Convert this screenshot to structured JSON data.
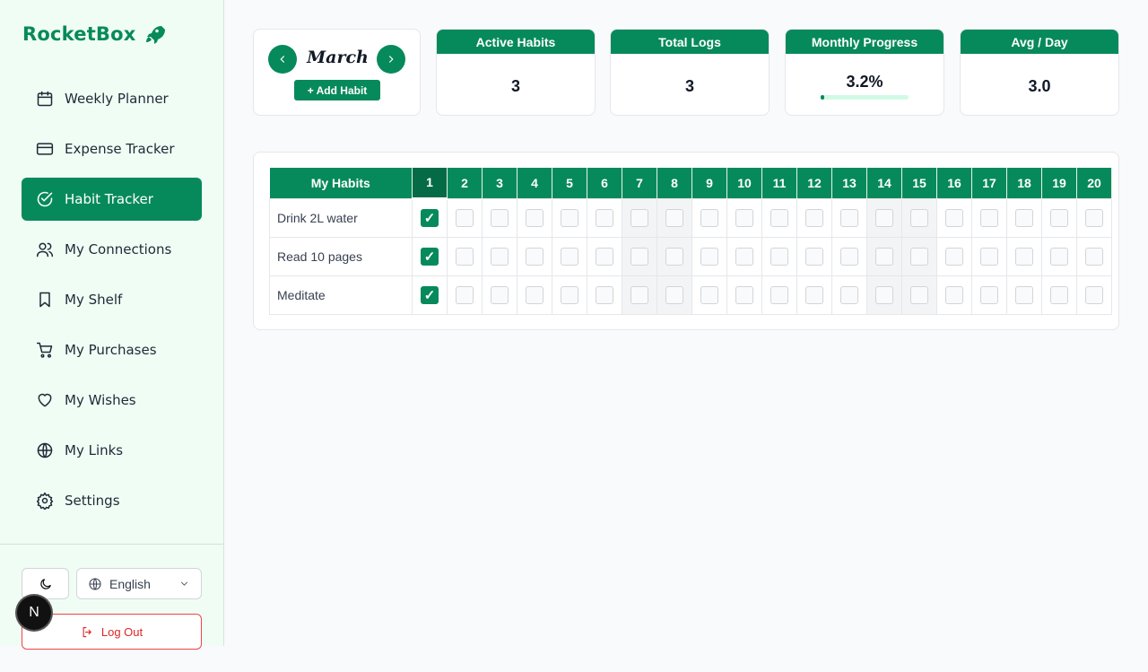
{
  "app": {
    "brand": "RocketBox"
  },
  "sidebar": {
    "items": [
      {
        "label": "Weekly Planner",
        "icon": "calendar-icon",
        "active": false
      },
      {
        "label": "Expense Tracker",
        "icon": "credit-card-icon",
        "active": false
      },
      {
        "label": "Habit Tracker",
        "icon": "check-circle-icon",
        "active": true
      },
      {
        "label": "My Connections",
        "icon": "users-icon",
        "active": false
      },
      {
        "label": "My Shelf",
        "icon": "bookmark-icon",
        "active": false
      },
      {
        "label": "My Purchases",
        "icon": "cart-icon",
        "active": false
      },
      {
        "label": "My Wishes",
        "icon": "heart-icon",
        "active": false
      },
      {
        "label": "My Links",
        "icon": "globe-icon",
        "active": false
      },
      {
        "label": "Settings",
        "icon": "gear-icon",
        "active": false
      }
    ],
    "language": "English",
    "logout_label": "Log Out",
    "badge": "N"
  },
  "header": {
    "month": "March",
    "add_habit_label": "+ Add Habit"
  },
  "stats": [
    {
      "title": "Active Habits",
      "value": "3"
    },
    {
      "title": "Total Logs",
      "value": "3"
    },
    {
      "title": "Monthly Progress",
      "value": "3.2%",
      "progress": 0.032
    },
    {
      "title": "Avg / Day",
      "value": "3.0"
    }
  ],
  "tracker": {
    "header": "My Habits",
    "days": [
      "1",
      "2",
      "3",
      "4",
      "5",
      "6",
      "7",
      "8",
      "9",
      "10",
      "11",
      "12",
      "13",
      "14",
      "15",
      "16",
      "17",
      "18",
      "19",
      "20"
    ],
    "today": "1",
    "weekend_days": [
      "7",
      "8",
      "14",
      "15"
    ],
    "habits": [
      {
        "name": "Drink 2L water",
        "done": [
          "1"
        ]
      },
      {
        "name": "Read 10 pages",
        "done": [
          "1"
        ]
      },
      {
        "name": "Meditate",
        "done": [
          "1"
        ]
      }
    ],
    "check_glyph": "✓"
  },
  "colors": {
    "accent": "#078a5b",
    "danger": "#dc2626"
  }
}
